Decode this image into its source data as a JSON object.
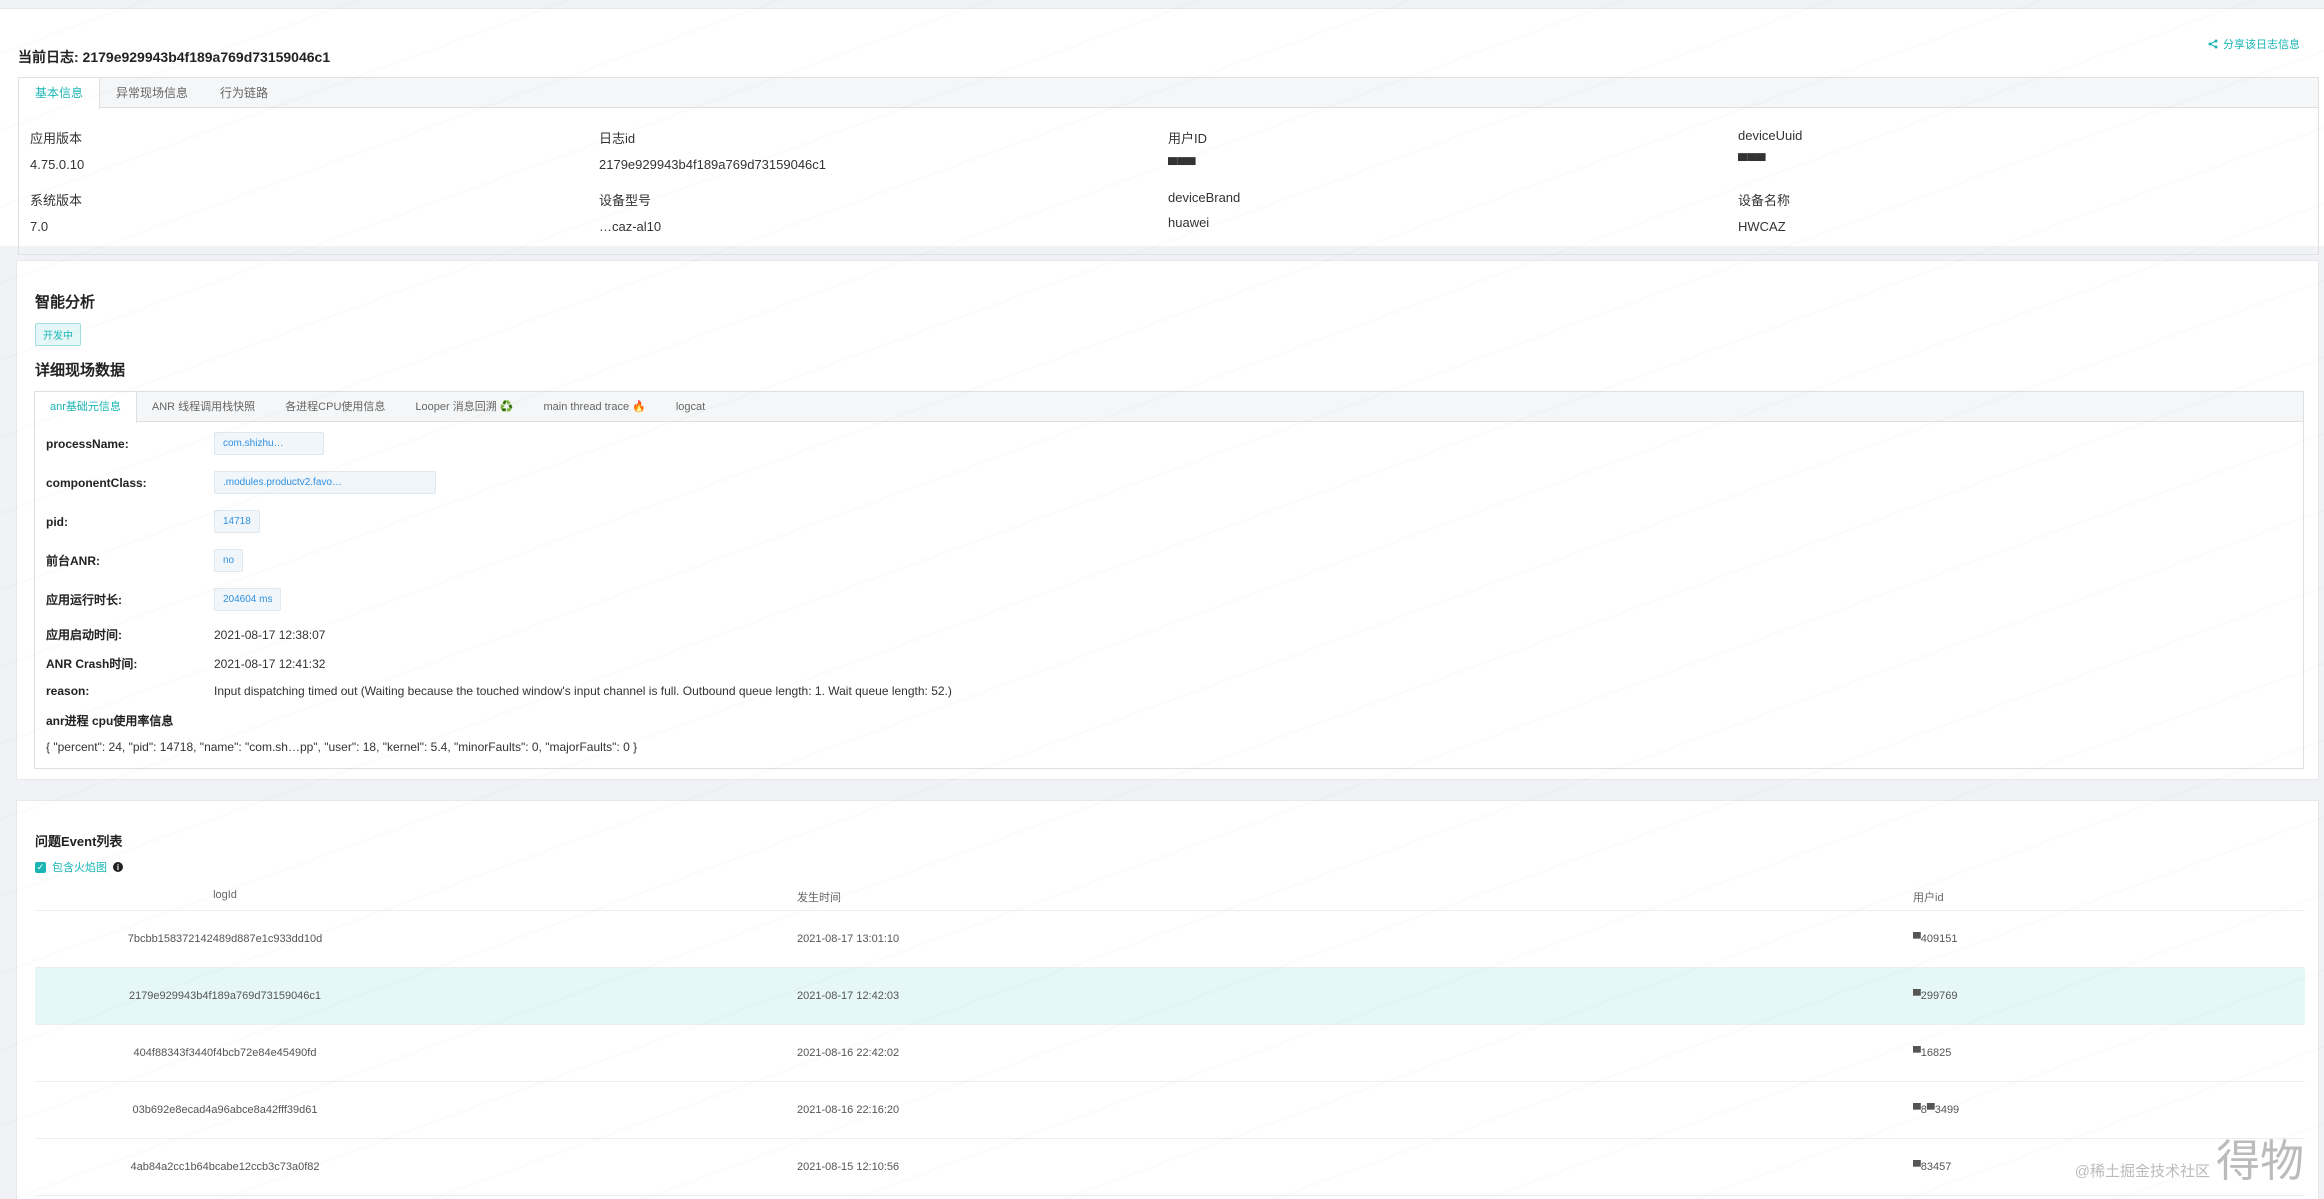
{
  "header": {
    "current_log_label": "当前日志: 2179e929943b4f189a769d73159046c1",
    "share_label": "分享该日志信息"
  },
  "basic_tabs": [
    "基本信息",
    "异常现场信息",
    "行为链路"
  ],
  "basic_info": [
    {
      "label": "应用版本",
      "value": "4.75.0.10"
    },
    {
      "label": "日志id",
      "value": "2179e929943b4f189a769d73159046c1"
    },
    {
      "label": "用户ID",
      "value": "▀▀▀"
    },
    {
      "label": "deviceUuid",
      "value": "▀▀▀"
    },
    {
      "label": "系统版本",
      "value": "7.0"
    },
    {
      "label": "设备型号",
      "value": "…caz-al10"
    },
    {
      "label": "deviceBrand",
      "value": "huawei"
    },
    {
      "label": "设备名称",
      "value": "HWCAZ"
    }
  ],
  "analysis": {
    "title": "智能分析",
    "dev_tag": "开发中",
    "detail_title": "详细现场数据"
  },
  "detail_tabs": [
    "anr基础元信息",
    "ANR 线程调用栈快照",
    "各进程CPU使用信息",
    "Looper 消息回溯 ♻️",
    "main thread trace 🔥",
    "logcat"
  ],
  "anr_meta": {
    "processName_key": "processName:",
    "processName_val": "com.shizhu…",
    "componentClass_key": "componentClass:",
    "componentClass_val": ".modules.productv2.favo…",
    "pid_key": "pid:",
    "pid_val": "14718",
    "foreground_key": "前台ANR:",
    "foreground_val": "no",
    "runtime_key": "应用运行时长:",
    "runtime_val": "204604 ms",
    "start_key": "应用启动时间:",
    "start_val": "2021-08-17 12:38:07",
    "crash_key": "ANR Crash时间:",
    "crash_val": "2021-08-17 12:41:32",
    "reason_key": "reason:",
    "reason_val": "Input dispatching timed out (Waiting because the touched window's input channel is full. Outbound queue length: 1. Wait queue length: 52.)",
    "cpu_title": "anr进程 cpu使用率信息",
    "cpu_json": "{ \"percent\": 24, \"pid\": 14718, \"name\": \"com.sh…pp\", \"user\": 18, \"kernel\": 5.4, \"minorFaults\": 0, \"majorFaults\": 0 }"
  },
  "events": {
    "title": "问题Event列表",
    "checkbox_label": "包含火焰图",
    "columns": [
      "logId",
      "发生时间",
      "用户id"
    ],
    "rows": [
      {
        "logId": "7bcbb158372142489d887e1c933dd10d",
        "time": "2021-08-17 13:01:10",
        "uid": "▀409151"
      },
      {
        "logId": "2179e929943b4f189a769d73159046c1",
        "time": "2021-08-17 12:42:03",
        "uid": "▀299769"
      },
      {
        "logId": "404f88343f3440f4bcb72e84e45490fd",
        "time": "2021-08-16 22:42:02",
        "uid": "▀16825"
      },
      {
        "logId": "03b692e8ecad4a96abce8a42fff39d61",
        "time": "2021-08-16 22:16:20",
        "uid": "▀8▀3499"
      },
      {
        "logId": "4ab84a2cc1b64bcabe12ccb3c73a0f82",
        "time": "2021-08-15 12:10:56",
        "uid": "▀83457"
      }
    ],
    "selected_index": 1
  },
  "footer": {
    "credit": "@稀土掘金技术社区",
    "brand": "得物"
  },
  "colors": {
    "accent": "#1bb5b5",
    "chip_text": "#2f8fe0",
    "selected_row": "#e6f7f7"
  }
}
